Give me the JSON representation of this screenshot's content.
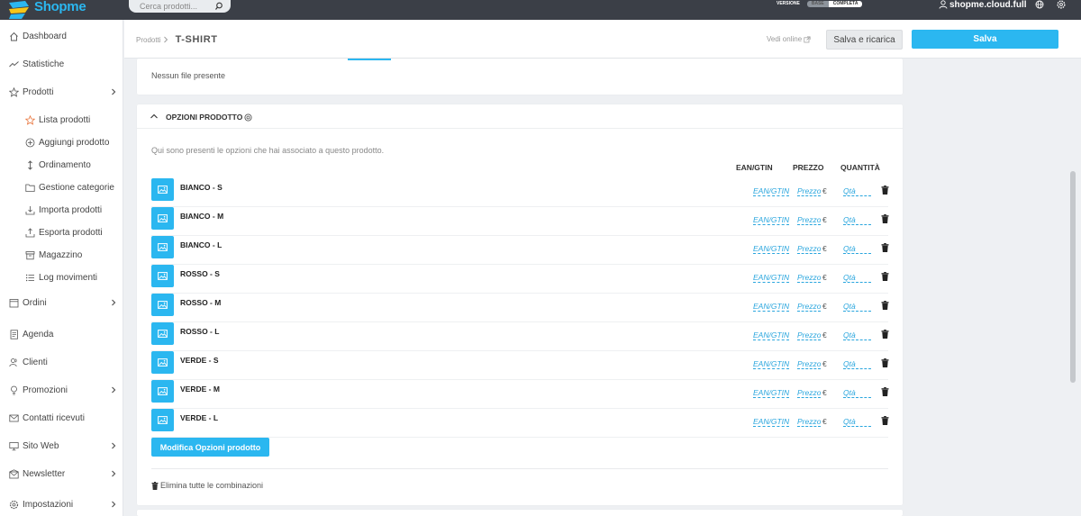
{
  "brand": {
    "name": "Shopme",
    "accent": "#2bb7f0",
    "topbar_color": "#3b3f47"
  },
  "search": {
    "placeholder": "Cerca prodotti..."
  },
  "version": {
    "label": "VERSIONE",
    "options": [
      "BASE",
      "COMPLETA"
    ],
    "selected": "COMPLETA"
  },
  "user": {
    "name": "shopme.cloud.full"
  },
  "sidebar": {
    "items": [
      {
        "label": "Dashboard",
        "icon": "home-icon"
      },
      {
        "label": "Statistiche",
        "icon": "trend-icon"
      },
      {
        "label": "Prodotti",
        "icon": "star-icon",
        "expandable": true
      },
      {
        "label": "Ordini",
        "icon": "calendar-icon",
        "expandable": true
      },
      {
        "label": "Agenda",
        "icon": "agenda-icon"
      },
      {
        "label": "Clienti",
        "icon": "users-icon"
      },
      {
        "label": "Promozioni",
        "icon": "bulb-icon",
        "expandable": true
      },
      {
        "label": "Contatti ricevuti",
        "icon": "mail-icon"
      },
      {
        "label": "Sito Web",
        "icon": "monitor-icon",
        "expandable": true
      },
      {
        "label": "Newsletter",
        "icon": "newsletter-icon",
        "expandable": true
      },
      {
        "label": "Impostazioni",
        "icon": "gear-icon",
        "expandable": true
      }
    ],
    "subitems": [
      {
        "label": "Lista prodotti",
        "icon": "star-outline-icon",
        "active": true
      },
      {
        "label": "Aggiungi prodotto",
        "icon": "plus-circle-icon"
      },
      {
        "label": "Ordinamento",
        "icon": "sort-icon"
      },
      {
        "label": "Gestione categorie",
        "icon": "folder-icon"
      },
      {
        "label": "Importa prodotti",
        "icon": "import-icon"
      },
      {
        "label": "Esporta prodotti",
        "icon": "export-icon"
      },
      {
        "label": "Magazzino",
        "icon": "warehouse-icon"
      },
      {
        "label": "Log movimenti",
        "icon": "list-icon"
      }
    ]
  },
  "header": {
    "breadcrumb": "Prodotti",
    "title": "T-SHIRT",
    "view_online": "Vedi online",
    "reload_label": "Salva e ricarica",
    "save_label": "Salva"
  },
  "files": {
    "empty_text": "Nessun file presente"
  },
  "options": {
    "title": "OPZIONI PRODOTTO",
    "description": "Qui sono presenti le opzioni che hai associato a questo prodotto.",
    "columns": {
      "ean": "EAN/GTIN",
      "price": "PREZZO",
      "qty": "QUANTITÀ"
    },
    "rows": [
      {
        "name": "BIANCO - S",
        "ean": "EAN/GTIN",
        "price": "Prezzo",
        "currency": "€",
        "qty": "Qtà"
      },
      {
        "name": "BIANCO - M",
        "ean": "EAN/GTIN",
        "price": "Prezzo",
        "currency": "€",
        "qty": "Qtà"
      },
      {
        "name": "BIANCO - L",
        "ean": "EAN/GTIN",
        "price": "Prezzo",
        "currency": "€",
        "qty": "Qtà"
      },
      {
        "name": "ROSSO - S",
        "ean": "EAN/GTIN",
        "price": "Prezzo",
        "currency": "€",
        "qty": "Qtà"
      },
      {
        "name": "ROSSO - M",
        "ean": "EAN/GTIN",
        "price": "Prezzo",
        "currency": "€",
        "qty": "Qtà"
      },
      {
        "name": "ROSSO - L",
        "ean": "EAN/GTIN",
        "price": "Prezzo",
        "currency": "€",
        "qty": "Qtà"
      },
      {
        "name": "VERDE - S",
        "ean": "EAN/GTIN",
        "price": "Prezzo",
        "currency": "€",
        "qty": "Qtà"
      },
      {
        "name": "VERDE - M",
        "ean": "EAN/GTIN",
        "price": "Prezzo",
        "currency": "€",
        "qty": "Qtà"
      },
      {
        "name": "VERDE - L",
        "ean": "EAN/GTIN",
        "price": "Prezzo",
        "currency": "€",
        "qty": "Qtà"
      }
    ],
    "modify_label": "Modifica Opzioni prodotto",
    "delete_all_label": "Elimina tutte le combinazioni"
  }
}
